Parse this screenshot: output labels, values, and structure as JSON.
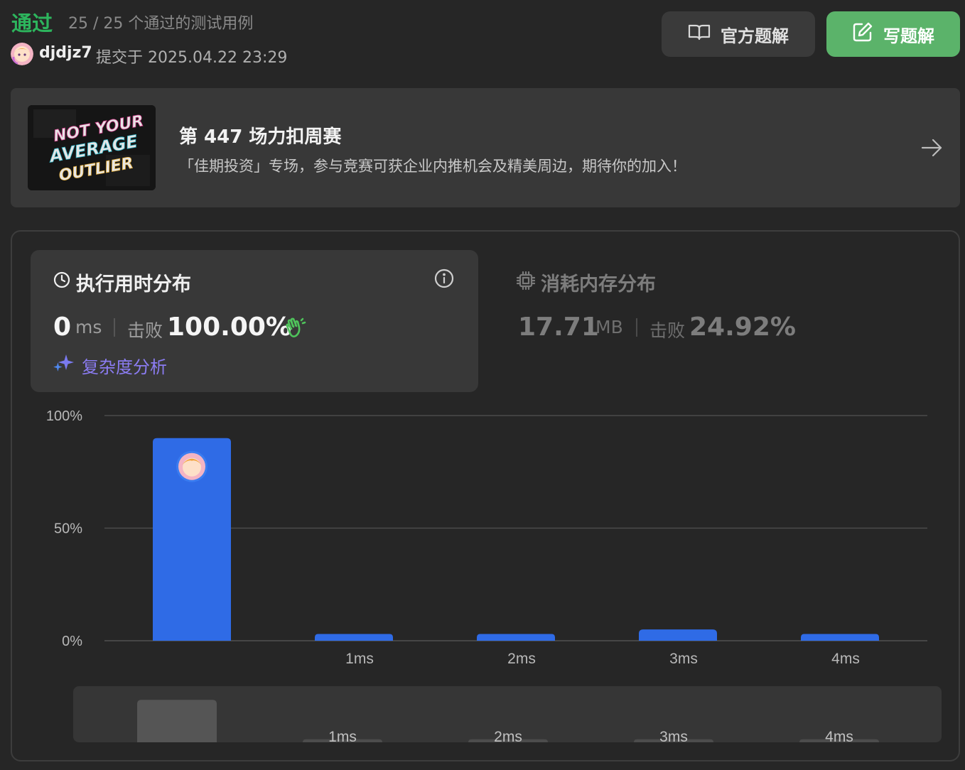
{
  "header": {
    "status": "通过",
    "cases": "25 / 25 个通过的测试用例",
    "username": "djdjz7",
    "submitted": "提交于 2025.04.22 23:29",
    "official_solution_label": "官方题解",
    "write_solution_label": "写题解"
  },
  "banner": {
    "image_text": [
      "NOT YOUR",
      "AVERAGE",
      "OUTLIER"
    ],
    "title": "第 447 场力扣周赛",
    "description": "「佳期投资」专场，参与竞赛可获企业内推机会及精美周边，期待你的加入！"
  },
  "runtime": {
    "title": "执行用时分布",
    "value": "0",
    "unit": "ms",
    "beat_label": "击败",
    "beat_value": "100.00%",
    "complexity_label": "复杂度分析"
  },
  "memory": {
    "title": "消耗内存分布",
    "value": "17.71",
    "unit": "MB",
    "beat_label": "击败",
    "beat_value": "24.92%"
  },
  "colors": {
    "accept": "#2db55d",
    "bar": "#2f6be6",
    "write_button": "#5bb36a",
    "complexity": "#8b7cf2"
  },
  "chart_data": {
    "type": "bar",
    "categories": [
      "",
      "1ms",
      "2ms",
      "3ms",
      "4ms"
    ],
    "values": [
      90,
      3,
      3,
      5,
      3
    ],
    "y_ticks": [
      "100%",
      "50%",
      "0%"
    ],
    "ylim": [
      0,
      100
    ],
    "grid": true,
    "overview_values": [
      75,
      3,
      3,
      3,
      3
    ]
  }
}
